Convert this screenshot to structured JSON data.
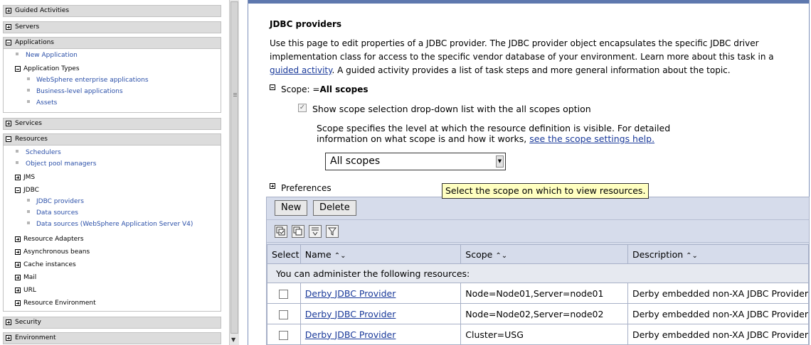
{
  "nav": {
    "sections": {
      "guided": {
        "label": "Guided Activities"
      },
      "servers": {
        "label": "Servers"
      },
      "applications": {
        "label": "Applications"
      },
      "services": {
        "label": "Services"
      },
      "resources": {
        "label": "Resources"
      },
      "security": {
        "label": "Security"
      },
      "environment": {
        "label": "Environment"
      }
    },
    "applications": {
      "new_application": "New Application",
      "application_types": "Application Types",
      "websphere_enterprise": "WebSphere enterprise applications",
      "business_level": "Business-level applications",
      "assets": "Assets"
    },
    "resources": {
      "schedulers": "Schedulers",
      "object_pool_managers": "Object pool managers",
      "jms": "JMS",
      "jdbc": "JDBC",
      "jdbc_providers": "JDBC providers",
      "data_sources": "Data sources",
      "data_sources_v4": "Data sources (WebSphere Application Server V4)",
      "resource_adapters": "Resource Adapters",
      "async_beans": "Asynchronous beans",
      "cache_instances": "Cache instances",
      "mail": "Mail",
      "url": "URL",
      "resource_environment": "Resource Environment"
    }
  },
  "page": {
    "title": "JDBC providers",
    "description_1": "Use this page to edit properties of a JDBC provider. The JDBC provider object encapsulates the specific JDBC driver implementation class for access to the specific vendor database of your environment. Learn more about this task in a ",
    "description_link": "guided activity",
    "description_2": ". A guided activity provides a list of task steps and more general information about the topic.",
    "scope_prefix": "Scope: =",
    "scope_value": "All scopes",
    "show_scope_label": "Show scope selection drop-down list with the all scopes option",
    "scope_help_1": "Scope specifies the level at which the resource definition is visible. For detailed information on what scope is and how it works, ",
    "scope_help_link": "see the scope settings help.",
    "scope_select_value": "All scopes",
    "preferences_label": "Preferences",
    "tooltip": "Select the scope on which to view resources."
  },
  "table": {
    "buttons": {
      "new": "New",
      "delete": "Delete"
    },
    "headers": {
      "select": "Select",
      "name": "Name",
      "scope": "Scope",
      "description": "Description"
    },
    "info": "You can administer the following resources:",
    "rows": [
      {
        "name": "Derby JDBC Provider",
        "scope": "Node=Node01,Server=node01",
        "description": "Derby embedded non-XA JDBC Provider"
      },
      {
        "name": "Derby JDBC Provider",
        "scope": "Node=Node02,Server=node02",
        "description": "Derby embedded non-XA JDBC Provider"
      },
      {
        "name": "Derby JDBC Provider",
        "scope": "Cluster=USG",
        "description": "Derby embedded non-XA JDBC Provider"
      }
    ]
  }
}
